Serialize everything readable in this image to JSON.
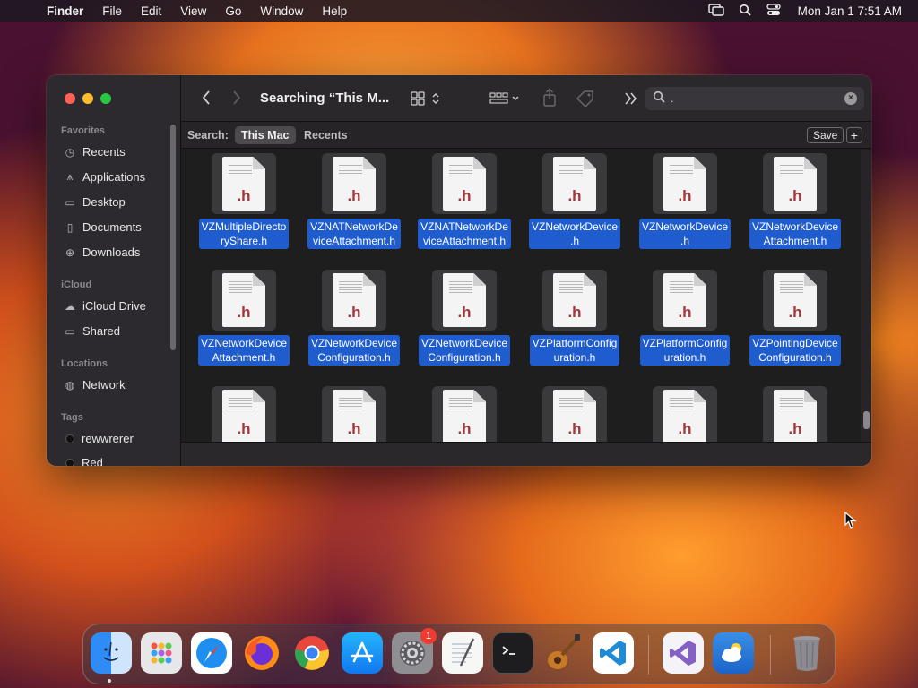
{
  "menubar": {
    "app_name": "Finder",
    "items": [
      "File",
      "Edit",
      "View",
      "Go",
      "Window",
      "Help"
    ],
    "clock": "Mon Jan 1  7:51 AM"
  },
  "sidebar": {
    "favorites_heading": "Favorites",
    "favorites": [
      {
        "label": "Recents",
        "icon": "clock-icon"
      },
      {
        "label": "Applications",
        "icon": "applications-icon"
      },
      {
        "label": "Desktop",
        "icon": "desktop-icon"
      },
      {
        "label": "Documents",
        "icon": "document-icon"
      },
      {
        "label": "Downloads",
        "icon": "download-icon"
      }
    ],
    "icloud_heading": "iCloud",
    "icloud": [
      {
        "label": "iCloud Drive",
        "icon": "cloud-icon"
      },
      {
        "label": "Shared",
        "icon": "shared-folder-icon"
      }
    ],
    "locations_heading": "Locations",
    "locations": [
      {
        "label": "Network",
        "icon": "globe-icon"
      }
    ],
    "tags_heading": "Tags",
    "tags": [
      {
        "label": "rewwrerer",
        "color": "#1b1b1b"
      },
      {
        "label": "Red",
        "color": "#1b1b1b"
      }
    ]
  },
  "toolbar": {
    "title": "Searching “This M...",
    "search_value": "."
  },
  "scopebar": {
    "label": "Search:",
    "scope_active": "This Mac",
    "scope_other": "Recents",
    "save_label": "Save",
    "add_label": "+"
  },
  "files": {
    "extension": ".h",
    "row1": [
      {
        "name": "VZMultipleDirectoryShare.h",
        "l1": "VZMultipleDirecto",
        "l2": "ryShare.h"
      },
      {
        "name": "VZNATNetworkDeviceAttachment.h",
        "l1": "VZNATNetworkDe",
        "l2": "viceAttachment.h"
      },
      {
        "name": "VZNATNetworkDeviceAttachment.h",
        "l1": "VZNATNetworkDe",
        "l2": "viceAttachment.h"
      },
      {
        "name": "VZNetworkDevice.h",
        "l1": "VZNetworkDevice",
        "l2": ".h"
      },
      {
        "name": "VZNetworkDevice.h",
        "l1": "VZNetworkDevice",
        "l2": ".h"
      },
      {
        "name": "VZNetworkDeviceAttachment.h",
        "l1": "VZNetworkDevice",
        "l2": "Attachment.h"
      }
    ],
    "row2": [
      {
        "name": "VZNetworkDeviceAttachment.h",
        "l1": "VZNetworkDevice",
        "l2": "Attachment.h"
      },
      {
        "name": "VZNetworkDeviceConfiguration.h",
        "l1": "VZNetworkDevice",
        "l2": "Configuration.h"
      },
      {
        "name": "VZNetworkDeviceConfiguration.h",
        "l1": "VZNetworkDevice",
        "l2": "Configuration.h"
      },
      {
        "name": "VZPlatformConfiguration.h",
        "l1": "VZPlatformConfig",
        "l2": "uration.h"
      },
      {
        "name": "VZPlatformConfiguration.h",
        "l1": "VZPlatformConfig",
        "l2": "uration.h"
      },
      {
        "name": "VZPointingDeviceConfiguration.h",
        "l1": "VZPointingDevice",
        "l2": "Configuration.h"
      }
    ]
  },
  "dock": {
    "apps": [
      {
        "name": "Finder",
        "icon": "finder-icon"
      },
      {
        "name": "Launchpad",
        "icon": "launchpad-icon"
      },
      {
        "name": "Safari",
        "icon": "safari-icon"
      },
      {
        "name": "Firefox",
        "icon": "firefox-icon"
      },
      {
        "name": "Chrome",
        "icon": "chrome-icon"
      },
      {
        "name": "App Store",
        "icon": "app-store-icon"
      },
      {
        "name": "System Settings",
        "icon": "gear-icon",
        "badge": "1"
      },
      {
        "name": "TextEdit",
        "icon": "textedit-icon"
      },
      {
        "name": "Terminal",
        "icon": "terminal-icon"
      },
      {
        "name": "Instruments",
        "icon": "guitar-icon"
      },
      {
        "name": "Visual Studio Code",
        "icon": "vscode-icon"
      },
      {
        "name": "Visual Studio",
        "icon": "visual-studio-icon"
      },
      {
        "name": "Weather",
        "icon": "weather-icon"
      },
      {
        "name": "Trash",
        "icon": "trash-icon"
      }
    ]
  }
}
